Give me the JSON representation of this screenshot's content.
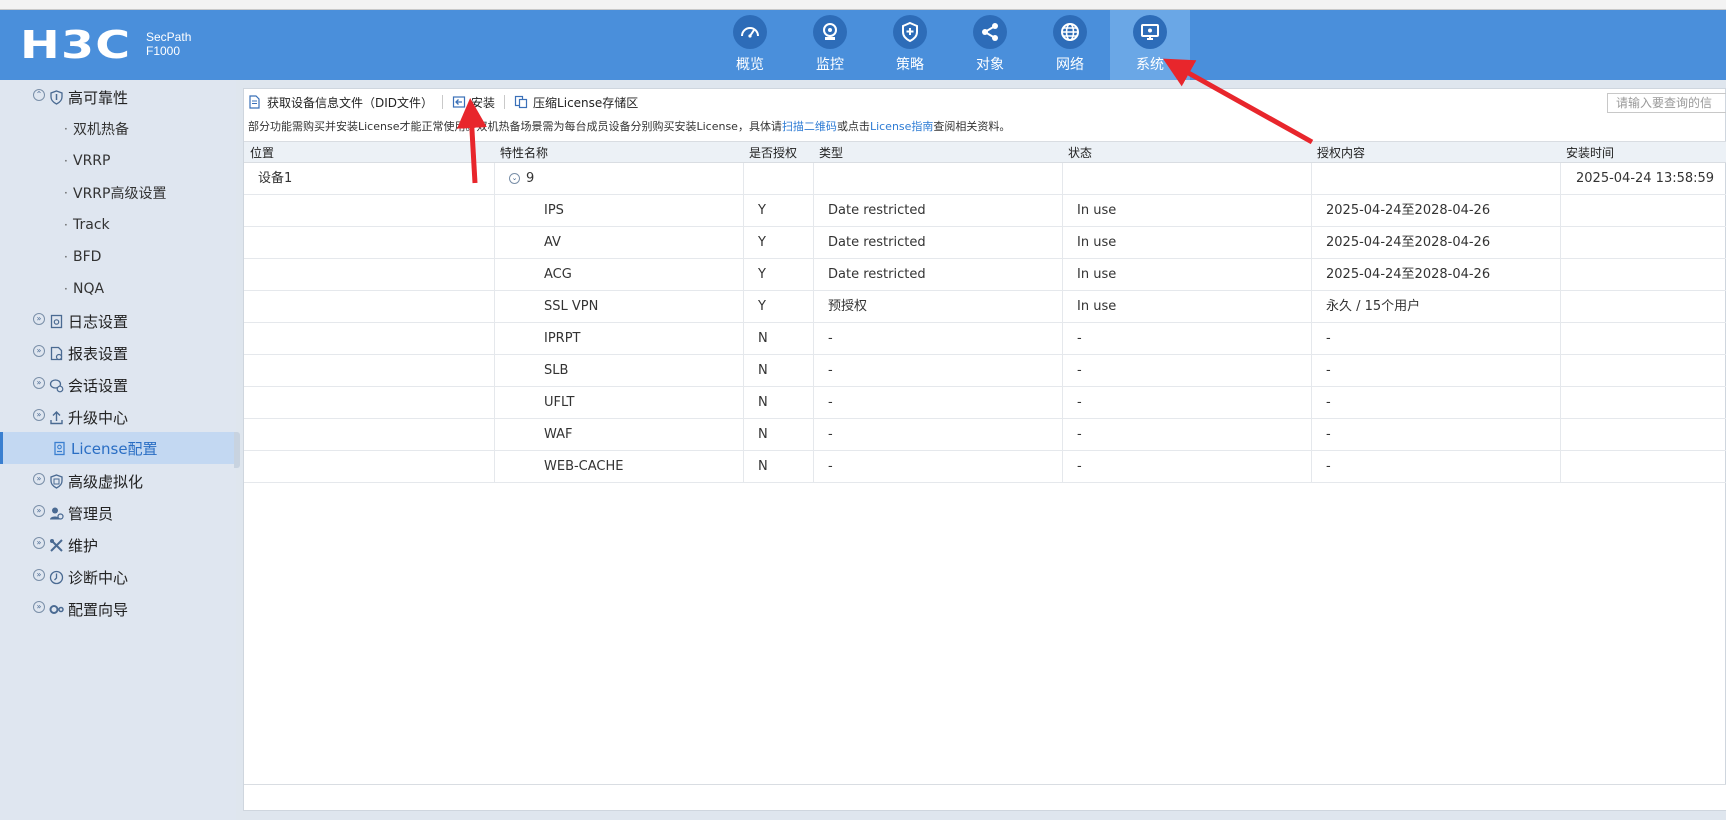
{
  "header": {
    "logo_text": "H3C",
    "product_line": "SecPath",
    "model": "F1000",
    "nav": [
      {
        "label": "概览",
        "icon": "dashboard-icon"
      },
      {
        "label": "监控",
        "icon": "monitor-icon"
      },
      {
        "label": "策略",
        "icon": "shield-icon"
      },
      {
        "label": "对象",
        "icon": "share-icon"
      },
      {
        "label": "网络",
        "icon": "globe-icon"
      },
      {
        "label": "系统",
        "icon": "system-icon",
        "active": true
      }
    ]
  },
  "sidebar": {
    "groups": [
      {
        "label": "高可靠性",
        "icon": "shield-icon",
        "expanded": true,
        "children": [
          "双机热备",
          "VRRP",
          "VRRP高级设置",
          "Track",
          "BFD",
          "NQA"
        ]
      },
      {
        "label": "日志设置",
        "icon": "log-icon"
      },
      {
        "label": "报表设置",
        "icon": "report-icon"
      },
      {
        "label": "会话设置",
        "icon": "session-icon"
      },
      {
        "label": "升级中心",
        "icon": "upload-icon"
      },
      {
        "label": "License配置",
        "icon": "license-icon",
        "active": true
      },
      {
        "label": "高级虚拟化",
        "icon": "virtualization-icon"
      },
      {
        "label": "管理员",
        "icon": "admin-icon"
      },
      {
        "label": "维护",
        "icon": "tools-icon"
      },
      {
        "label": "诊断中心",
        "icon": "diagnose-icon"
      },
      {
        "label": "配置向导",
        "icon": "wizard-icon"
      }
    ]
  },
  "toolbar": {
    "get_did": "获取设备信息文件（DID文件）",
    "install": "安装",
    "compress": "压缩License存储区",
    "search_placeholder": "请输入要查询的信"
  },
  "notice": {
    "text1": "部分功能需购买并安装License才能正常使用。双机热备场景需为每台成员设备分别购买安装License，具体请",
    "link1": "扫描二维码",
    "text2": "或点击",
    "link2": "License指南",
    "text3": "查阅相关资料。"
  },
  "table": {
    "columns": [
      "位置",
      "特性名称",
      "是否授权",
      "类型",
      "状态",
      "授权内容",
      "安装时间"
    ],
    "group_row": {
      "location": "设备1",
      "count": "9",
      "install_time": "2025-04-24 13:58:59"
    },
    "rows": [
      {
        "feature": "IPS",
        "authorized": "Y",
        "type": "Date restricted",
        "status": "In use",
        "content": "2025-04-24至2028-04-26"
      },
      {
        "feature": "AV",
        "authorized": "Y",
        "type": "Date restricted",
        "status": "In use",
        "content": "2025-04-24至2028-04-26"
      },
      {
        "feature": "ACG",
        "authorized": "Y",
        "type": "Date restricted",
        "status": "In use",
        "content": "2025-04-24至2028-04-26"
      },
      {
        "feature": "SSL VPN",
        "authorized": "Y",
        "type": "预授权",
        "status": "In use",
        "content": "永久 / 15个用户"
      },
      {
        "feature": "IPRPT",
        "authorized": "N",
        "type": "-",
        "status": "-",
        "content": "-"
      },
      {
        "feature": "SLB",
        "authorized": "N",
        "type": "-",
        "status": "-",
        "content": "-"
      },
      {
        "feature": "UFLT",
        "authorized": "N",
        "type": "-",
        "status": "-",
        "content": "-"
      },
      {
        "feature": "WAF",
        "authorized": "N",
        "type": "-",
        "status": "-",
        "content": "-"
      },
      {
        "feature": "WEB-CACHE",
        "authorized": "N",
        "type": "-",
        "status": "-",
        "content": "-"
      }
    ]
  },
  "colors": {
    "header_bg": "#4a8fdb",
    "nav_active": "#6aa7e6",
    "annotation_arrow": "#e8262c",
    "link": "#2d7bd4"
  }
}
